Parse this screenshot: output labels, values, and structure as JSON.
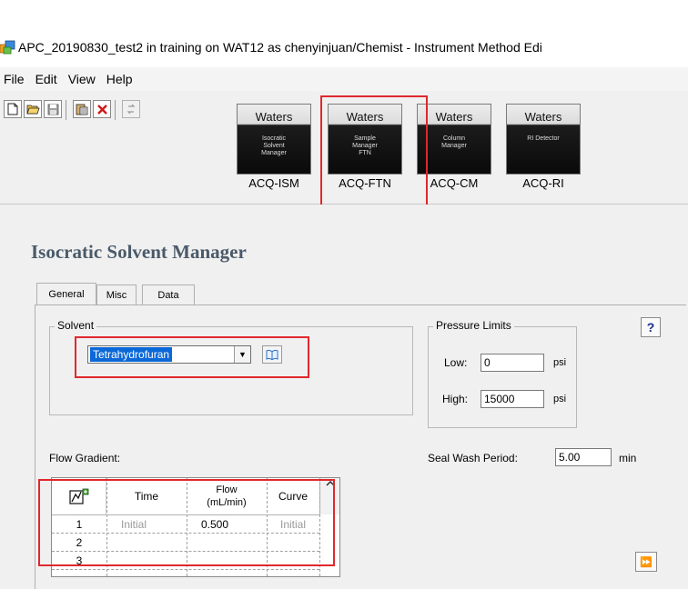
{
  "window": {
    "title": "APC_20190830_test2 in training on WAT12 as chenyinjuan/Chemist - Instrument Method Edi"
  },
  "menu": [
    "File",
    "Edit",
    "View",
    "Help"
  ],
  "toolbar": {
    "icons": [
      "new-icon",
      "open-icon",
      "save-icon",
      "paste-icon",
      "delete-icon",
      "refresh-icon"
    ]
  },
  "modules": [
    {
      "brand": "Waters",
      "subtitle": "Isocratic\nSolvent\nManager",
      "label": "ACQ-ISM"
    },
    {
      "brand": "Waters",
      "subtitle": "Sample\nManager\nFTN",
      "label": "ACQ-FTN"
    },
    {
      "brand": "Waters",
      "subtitle": "Column\nManager",
      "label": "ACQ-CM"
    },
    {
      "brand": "Waters",
      "subtitle": "RI Detector",
      "label": "ACQ-RI"
    }
  ],
  "panel": {
    "title": "Isocratic Solvent Manager",
    "tabs": [
      "General",
      "Misc",
      "Data"
    ],
    "solvent": {
      "group_label": "Solvent",
      "selected": "Tetrahydrofuran"
    },
    "pressure": {
      "group_label": "Pressure Limits",
      "low_label": "Low:",
      "low_value": "0",
      "high_label": "High:",
      "high_value": "15000",
      "unit": "psi"
    },
    "help": "?",
    "flow_gradient_label": "Flow Gradient:",
    "seal_wash": {
      "label": "Seal Wash Period:",
      "value": "5.00",
      "unit": "min"
    },
    "table": {
      "headers": {
        "time": "Time",
        "flow": "Flow\n(mL/min)",
        "curve": "Curve"
      },
      "rows": [
        {
          "num": "1",
          "time": "Initial",
          "flow": "0.500",
          "curve": "Initial"
        },
        {
          "num": "2",
          "time": "",
          "flow": "",
          "curve": ""
        },
        {
          "num": "3",
          "time": "",
          "flow": "",
          "curve": ""
        }
      ]
    },
    "next_button": "⏩"
  },
  "colors": {
    "highlight_box": "#e0282d",
    "selection": "#0a68d8",
    "panel_title": "#4a5a6a"
  }
}
